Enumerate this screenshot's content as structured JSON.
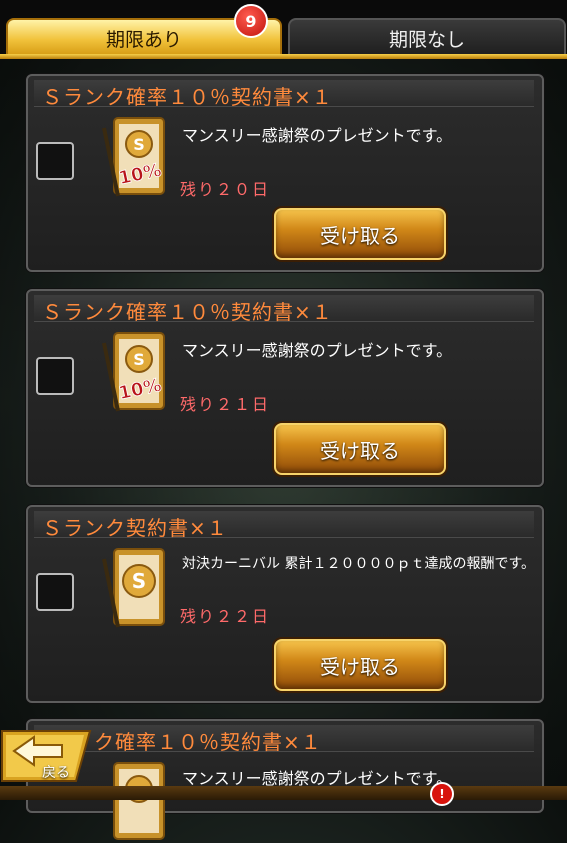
{
  "tabs": {
    "active": {
      "label": "期限あり",
      "badge": "9"
    },
    "inactive": {
      "label": "期限なし"
    }
  },
  "cards": [
    {
      "title": "Ｓランク確率１０％契約書×１",
      "description": "マンスリー感謝祭のプレゼントです。",
      "remaining": "残り２０日",
      "button": "受け取る",
      "icon_label": "10%",
      "icon": "s-rank-10-percent-contract-icon"
    },
    {
      "title": "Ｓランク確率１０％契約書×１",
      "description": "マンスリー感謝祭のプレゼントです。",
      "remaining": "残り２１日",
      "button": "受け取る",
      "icon_label": "10%",
      "icon": "s-rank-10-percent-contract-icon"
    },
    {
      "title": "Ｓランク契約書×１",
      "description": "対決カーニバル 累計１２００００ｐｔ達成の報酬です。",
      "remaining": "残り２２日",
      "button": "受け取る",
      "icon": "s-rank-contract-icon"
    },
    {
      "title": "ク確率１０％契約書×１",
      "description": "マンスリー感謝祭のプレゼントです。",
      "icon": "s-rank-10-percent-contract-icon"
    }
  ],
  "back_button": {
    "label": "戻る",
    "icon": "back-arrow-icon"
  },
  "bottom_nav": {
    "alert_badge": "!"
  },
  "colors": {
    "title_orange": "#ff8a3c",
    "remaining_red": "#ff6a6a",
    "tab_gold": "#f1c23b",
    "button_orange": "#d18818"
  }
}
